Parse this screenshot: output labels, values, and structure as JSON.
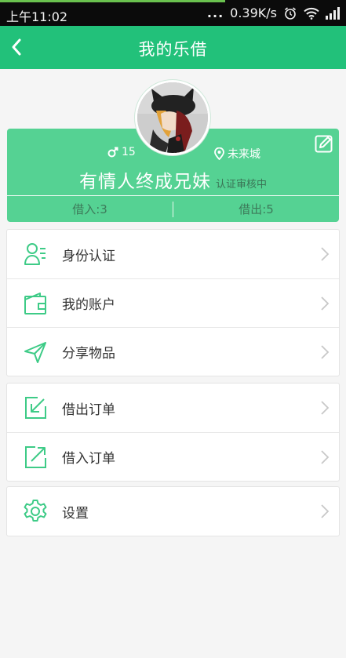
{
  "status_bar": {
    "time": "上午11:02",
    "dots": "...",
    "speed": "0.39K/s"
  },
  "app_bar": {
    "title": "我的乐借"
  },
  "profile": {
    "age": "15",
    "location": "未来城",
    "name": "有情人终成兄妹",
    "verify_status": "认证审核中",
    "borrow_in": "借入:3",
    "borrow_out": "借出:5"
  },
  "menu": {
    "identity": "身份认证",
    "account": "我的账户",
    "share": "分享物品",
    "lend_orders": "借出订单",
    "borrow_orders": "借入订单",
    "settings": "设置"
  },
  "colors": {
    "primary": "#22c17a",
    "card": "#55d293",
    "icon": "#3ecb87"
  }
}
